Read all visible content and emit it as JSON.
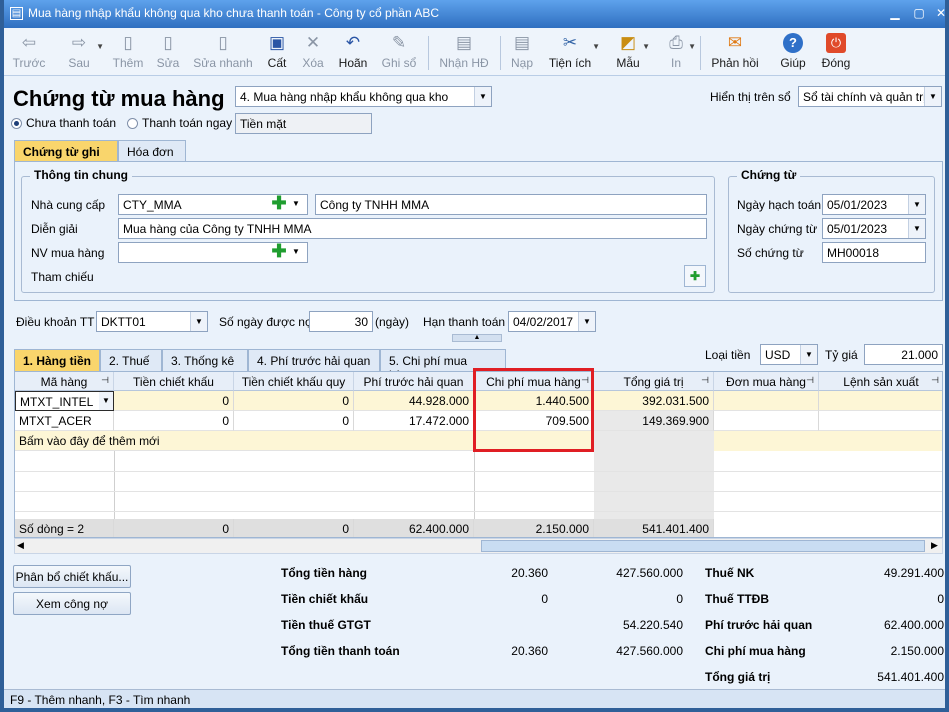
{
  "window": {
    "title": "Mua hàng nhập khẩu không qua kho chưa thanh toán - Công ty cổ phần ABC"
  },
  "toolbar": {
    "items": [
      {
        "label": "Trước",
        "icon": "arrow-left-icon",
        "glyph": "⇦"
      },
      {
        "label": "Sau",
        "icon": "arrow-right-icon",
        "glyph": "⇨"
      },
      {
        "label": "Thêm",
        "icon": "new-document-icon",
        "glyph": "▯"
      },
      {
        "label": "Sửa",
        "icon": "edit-document-icon",
        "glyph": "▯"
      },
      {
        "label": "Sửa nhanh",
        "icon": "quick-edit-icon",
        "glyph": "▯"
      },
      {
        "label": "Cất",
        "icon": "save-icon",
        "glyph": "▣"
      },
      {
        "label": "Xóa",
        "icon": "delete-icon",
        "glyph": "✕"
      },
      {
        "label": "Hoãn",
        "icon": "undo-icon",
        "glyph": "↶"
      },
      {
        "label": "Ghi sổ",
        "icon": "pencil-icon",
        "glyph": "✎"
      },
      {
        "label": "Nhận HĐ",
        "icon": "receive-invoice-icon",
        "glyph": "▤"
      },
      {
        "label": "Nạp",
        "icon": "reload-icon",
        "glyph": "▤"
      },
      {
        "label": "Tiện ích",
        "icon": "tools-icon",
        "glyph": "✂"
      },
      {
        "label": "Mẫu",
        "icon": "template-icon",
        "glyph": "◩"
      },
      {
        "label": "In",
        "icon": "print-icon",
        "glyph": "⎙"
      },
      {
        "label": "Phản hồi",
        "icon": "mail-icon",
        "glyph": "✉"
      },
      {
        "label": "Giúp",
        "icon": "help-icon",
        "glyph": "?"
      },
      {
        "label": "Đóng",
        "icon": "power-icon",
        "glyph": "⏻"
      }
    ]
  },
  "header": {
    "title": "Chứng từ mua hàng",
    "voucher_type": "4. Mua hàng nhập khẩu không qua kho",
    "display_label": "Hiển thị trên sổ",
    "display_value": "Sổ tài chính và quản trị",
    "radio_unpaid": "Chưa thanh toán",
    "radio_paid": "Thanh toán ngay",
    "payment_method": "Tiền mặt"
  },
  "tabs": [
    "Chứng từ ghi nợ",
    "Hóa đơn"
  ],
  "general": {
    "group_title": "Thông tin chung",
    "supplier_label": "Nhà cung cấp",
    "supplier_code": "CTY_MMA",
    "supplier_name": "Công ty TNHH MMA",
    "desc_label": "Diễn giải",
    "desc_value": "Mua hàng của Công ty TNHH MMA",
    "buyer_label": "NV mua hàng",
    "ref_label": "Tham chiếu"
  },
  "voucher": {
    "group_title": "Chứng từ",
    "post_date_label": "Ngày hạch toán",
    "post_date": "05/01/2023",
    "doc_date_label": "Ngày chứng từ",
    "doc_date": "05/01/2023",
    "doc_no_label": "Số chứng từ",
    "doc_no": "MH00018"
  },
  "terms": {
    "term_label": "Điều khoản TT",
    "term_value": "DKTT01",
    "days_label": "Số ngày được nợ",
    "days_value": "30",
    "days_unit": "(ngày)",
    "due_label": "Hạn thanh toán",
    "due_value": "04/02/2017"
  },
  "detail_tabs": [
    "1. Hàng tiền",
    "2. Thuế",
    "3. Thống kê",
    "4. Phí trước hải quan",
    "5. Chi phí mua hàng"
  ],
  "currency": {
    "label": "Loại tiền",
    "value": "USD",
    "rate_label": "Tỷ giá",
    "rate_value": "21.000"
  },
  "grid": {
    "columns": [
      "Mã hàng",
      "Tiền chiết khấu",
      "Tiền chiết khấu quy",
      "Phí trước hải quan",
      "Chi phí mua hàng",
      "Tổng giá trị",
      "Đơn mua hàng",
      "Lệnh sản xuất"
    ],
    "rows": [
      [
        "MTXT_INTEL",
        "0",
        "0",
        "44.928.000",
        "1.440.500",
        "392.031.500",
        "",
        ""
      ],
      [
        "MTXT_ACER",
        "0",
        "0",
        "17.472.000",
        "709.500",
        "149.369.900",
        "",
        ""
      ]
    ],
    "add_new": "Bấm vào đây để thêm mới",
    "footer": [
      "Số dòng = 2",
      "0",
      "0",
      "62.400.000",
      "2.150.000",
      "541.401.400",
      "",
      ""
    ]
  },
  "buttons": {
    "allocate": "Phân bổ chiết khấu...",
    "view_debt": "Xem công nợ"
  },
  "summary": {
    "left": [
      {
        "label": "Tổng tiền hàng",
        "v1": "20.360",
        "v2": "427.560.000"
      },
      {
        "label": "Tiền chiết khấu",
        "v1": "0",
        "v2": "0"
      },
      {
        "label": "Tiền thuế GTGT",
        "v1": "",
        "v2": "54.220.540"
      },
      {
        "label": "Tổng tiền thanh toán",
        "v1": "20.360",
        "v2": "427.560.000"
      }
    ],
    "right": [
      {
        "label": "Thuế NK",
        "v": "49.291.400"
      },
      {
        "label": "Thuế TTĐB",
        "v": "0"
      },
      {
        "label": "Phí trước hải quan",
        "v": "62.400.000"
      },
      {
        "label": "Chi phí mua hàng",
        "v": "2.150.000"
      },
      {
        "label": "Tổng giá trị",
        "v": "541.401.400"
      }
    ]
  },
  "status": "F9 - Thêm nhanh, F3 - Tìm nhanh",
  "colors": {
    "titlebar": "#2f6fc0",
    "active_tab": "#f9d56c",
    "highlight": "#e01e24",
    "selected_row": "#fdf6d6"
  }
}
